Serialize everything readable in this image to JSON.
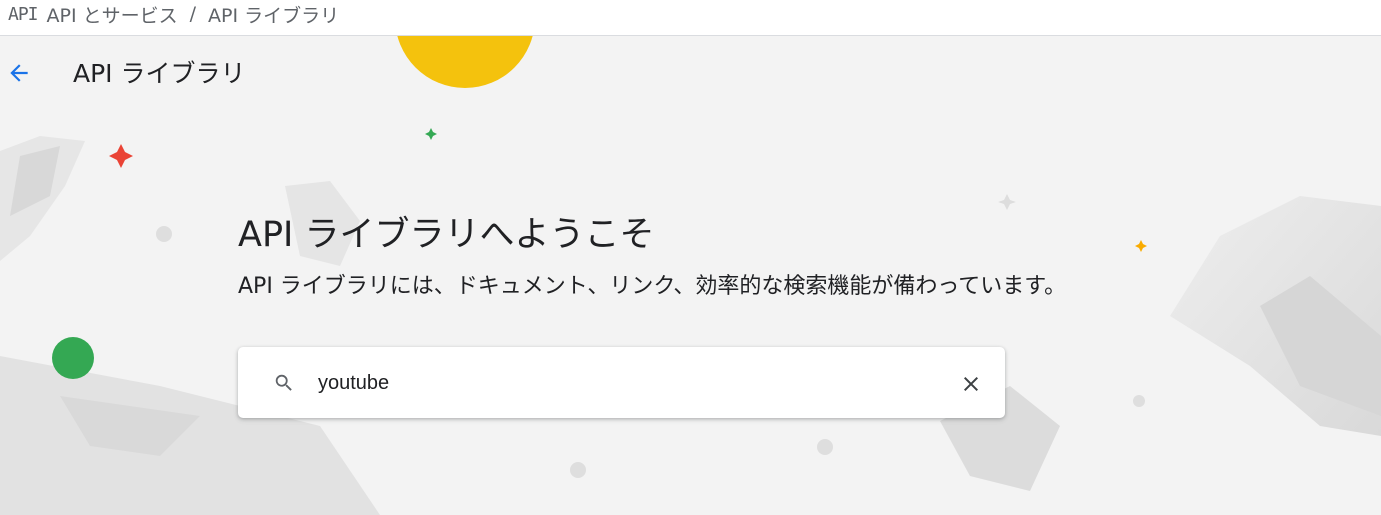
{
  "breadcrumb": {
    "logo": "API",
    "parent": "API とサービス",
    "separator": "/",
    "current": "API ライブラリ"
  },
  "header": {
    "title": "API ライブラリ",
    "back_icon": "arrow-back-icon"
  },
  "hero": {
    "heading": "API ライブラリへようこそ",
    "subheading": "API ライブラリには、ドキュメント、リンク、効率的な検索機能が備わっています。"
  },
  "search": {
    "value": "youtube",
    "placeholder": "",
    "icon": "search-icon",
    "clear_icon": "close-icon"
  },
  "colors": {
    "accent": "#1a73e8",
    "hero_background": "#f3f3f3",
    "yellow_decor": "#f4c20d",
    "green_decor": "#34a853",
    "red_decor": "#ea4335"
  }
}
